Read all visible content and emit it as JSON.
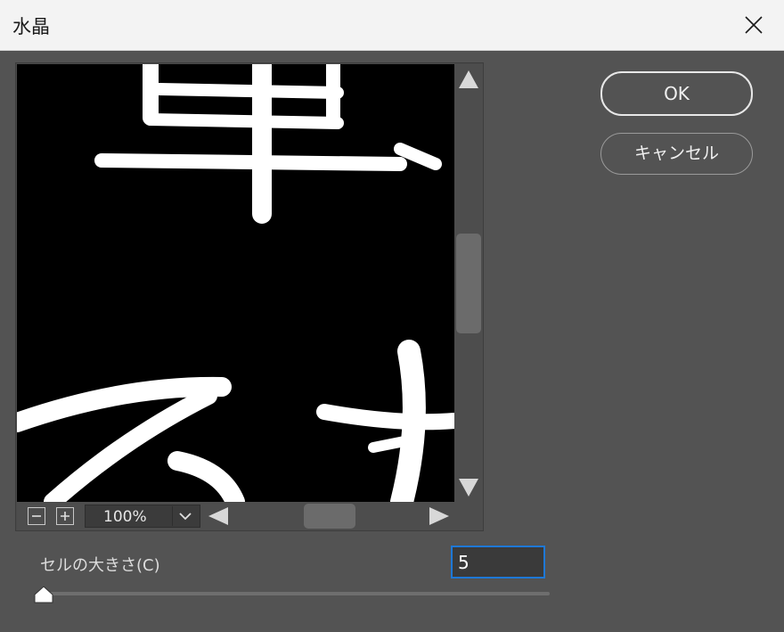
{
  "window": {
    "title": "水晶"
  },
  "preview": {
    "zoom_minus_icon": "minus-icon",
    "zoom_plus_icon": "plus-icon",
    "zoom_value": "100%"
  },
  "buttons": {
    "ok_label": "OK",
    "cancel_label": "キャンセル"
  },
  "cell_size": {
    "label": "セルの大きさ(C)",
    "value": "5",
    "slider_value": 5
  },
  "colors": {
    "accent": "#1e78d6",
    "panel": "#535353",
    "preview_bg": "#000000"
  }
}
